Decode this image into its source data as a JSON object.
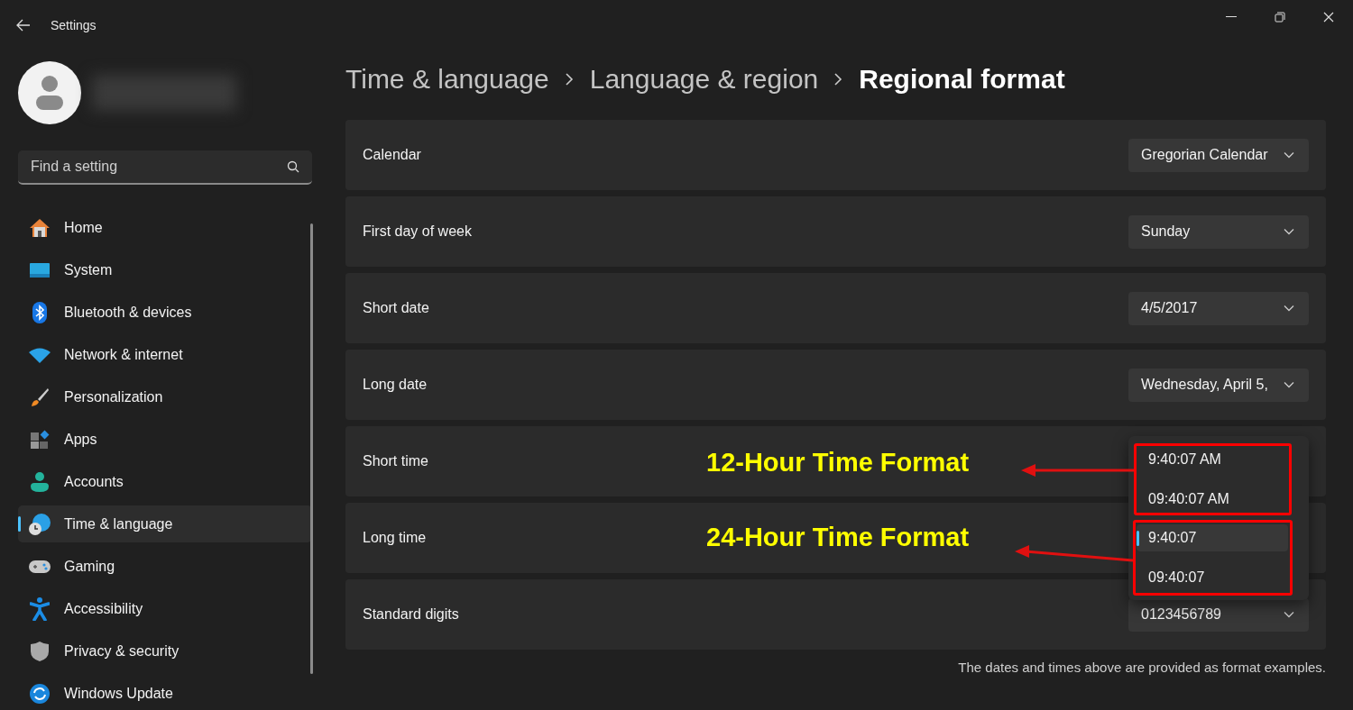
{
  "window": {
    "title": "Settings"
  },
  "sidebar": {
    "search": {
      "placeholder": "Find a setting"
    },
    "items": [
      {
        "label": "Home",
        "selected": false
      },
      {
        "label": "System",
        "selected": false
      },
      {
        "label": "Bluetooth & devices",
        "selected": false
      },
      {
        "label": "Network & internet",
        "selected": false
      },
      {
        "label": "Personalization",
        "selected": false
      },
      {
        "label": "Apps",
        "selected": false
      },
      {
        "label": "Accounts",
        "selected": false
      },
      {
        "label": "Time & language",
        "selected": true
      },
      {
        "label": "Gaming",
        "selected": false
      },
      {
        "label": "Accessibility",
        "selected": false
      },
      {
        "label": "Privacy & security",
        "selected": false
      },
      {
        "label": "Windows Update",
        "selected": false
      }
    ]
  },
  "breadcrumb": [
    {
      "label": "Time & language",
      "current": false
    },
    {
      "label": "Language & region",
      "current": false
    },
    {
      "label": "Regional format",
      "current": true
    }
  ],
  "settings": [
    {
      "label": "Calendar",
      "value": "Gregorian Calendar"
    },
    {
      "label": "First day of week",
      "value": "Sunday"
    },
    {
      "label": "Short date",
      "value": "4/5/2017"
    },
    {
      "label": "Long date",
      "value": "Wednesday, April 5,"
    },
    {
      "label": "Short time"
    },
    {
      "label": "Long time"
    },
    {
      "label": "Standard digits",
      "value": "0123456789"
    }
  ],
  "dropdown": {
    "options": [
      {
        "label": "9:40:07 AM",
        "selected": false
      },
      {
        "label": "09:40:07 AM",
        "selected": false
      },
      {
        "label": "9:40:07",
        "selected": true
      },
      {
        "label": "09:40:07",
        "selected": false
      }
    ]
  },
  "footnote": "The dates and times above are provided as format examples.",
  "annotations": [
    {
      "text": "12-Hour Time Format"
    },
    {
      "text": "24-Hour Time Format"
    }
  ]
}
